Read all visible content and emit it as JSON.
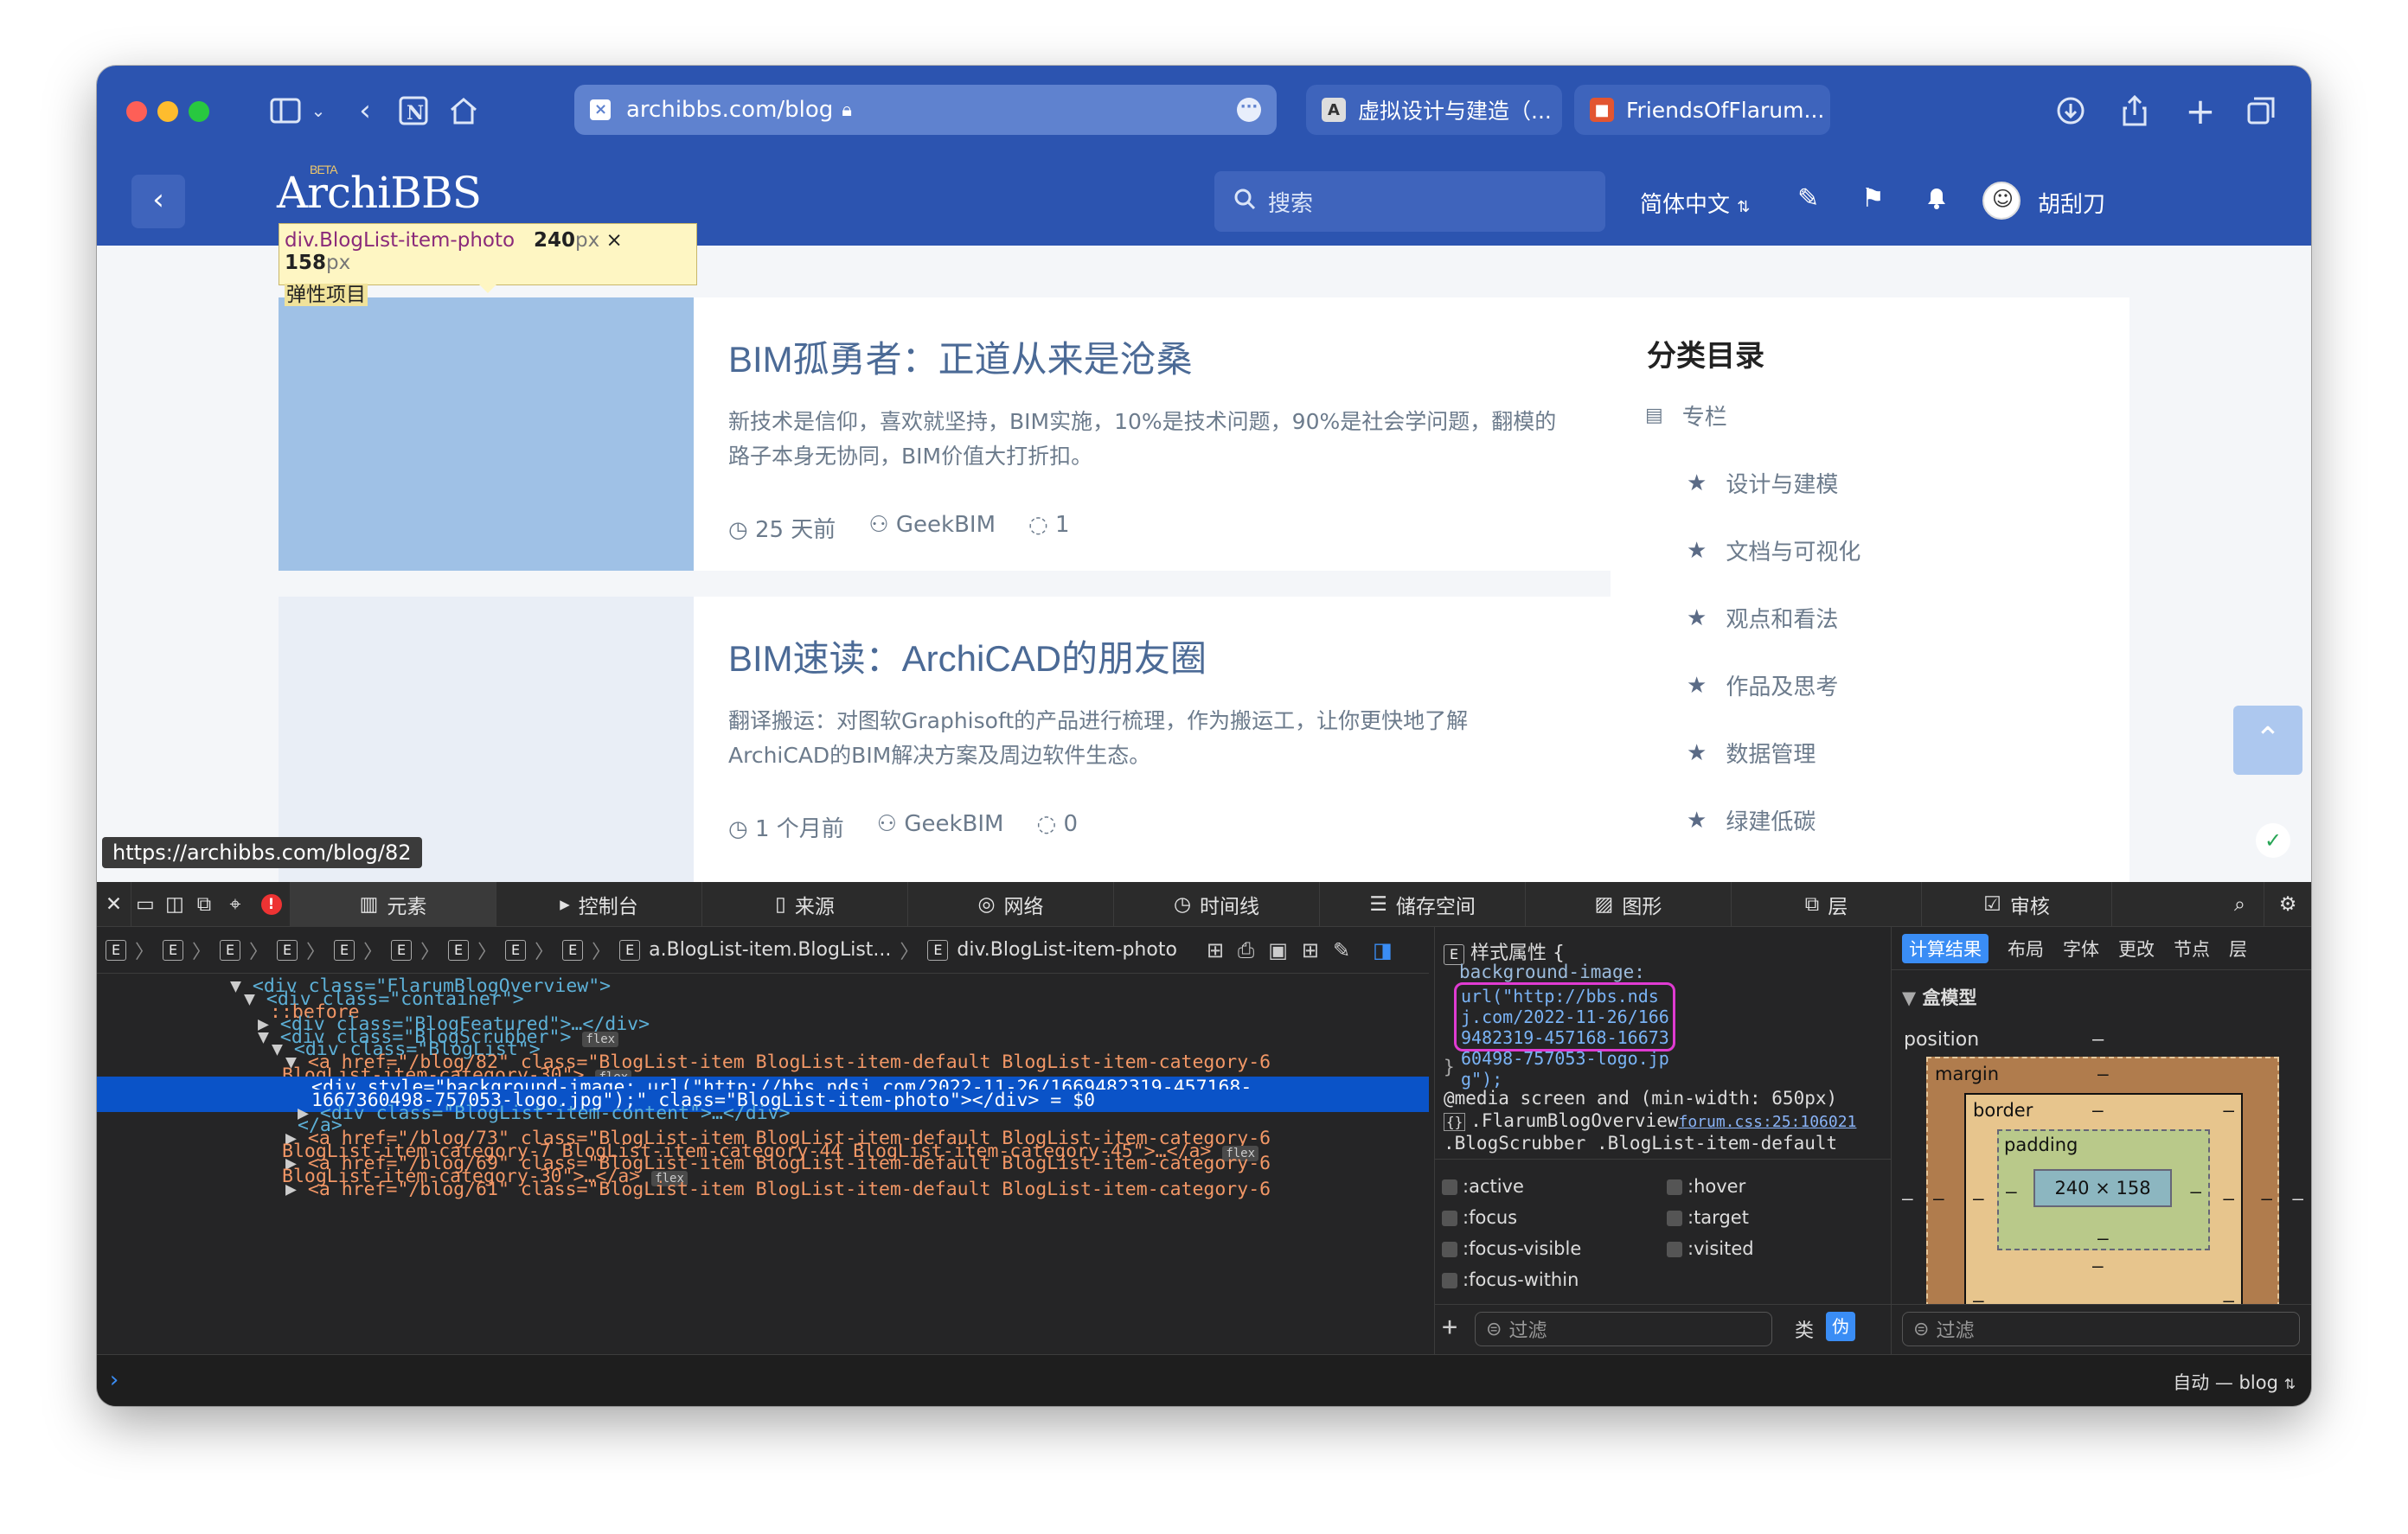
{
  "browser": {
    "url": "archibbs.com/blog",
    "tabs": [
      {
        "label": "虚拟设计与建造（..."
      },
      {
        "label": "FriendsOfFlarum..."
      }
    ]
  },
  "site": {
    "logo": "ArchiBBS",
    "logo_badge": "BETA",
    "search_placeholder": "搜索",
    "language": "简体中文",
    "username": "胡刮刀"
  },
  "tooltip": {
    "selector": "div.BlogList-item-photo",
    "size_w": "240",
    "size_h": "158",
    "unit": "px",
    "times": " × ",
    "label": "弹性项目"
  },
  "posts": [
    {
      "title": "BIM孤勇者：正道从来是沧桑",
      "excerpt": "新技术是信仰，喜欢就坚持，BIM实施，10%是技术问题，90%是社会学问题，翻模的路子本身无协同，BIM价值大打折扣。",
      "time": "25 天前",
      "author": "GeekBIM",
      "comments": "1",
      "photo_color": "#9fc1e6"
    },
    {
      "title": "BIM速读：ArchiCAD的朋友圈",
      "excerpt": "翻译搬运：对图软Graphisoft的产品进行梳理，作为搬运工，让你更快地了解ArchiCAD的BIM解决方案及周边软件生态。",
      "time": "1 个月前",
      "author": "GeekBIM",
      "comments": "0",
      "photo_color": "#e9eef6"
    }
  ],
  "sidebar": {
    "title": "分类目录",
    "root": "专栏",
    "items": [
      "设计与建模",
      "文档与可视化",
      "观点和看法",
      "作品及思考",
      "数据管理",
      "绿建低碳"
    ]
  },
  "status_url": "https://archibbs.com/blog/82",
  "devtools": {
    "tabs": [
      "元素",
      "控制台",
      "来源",
      "网络",
      "时间线",
      "储存空间",
      "图形",
      "层",
      "审核"
    ],
    "breadcrumb_a": "a.BlogList-item.BlogList...",
    "breadcrumb_div": "div.BlogList-item-photo",
    "dom_lines": [
      "<div class=\"FlarumBlogOverview\">",
      "<div class=\"container\">",
      "::before",
      "<div class=\"BlogFeatured\">…</div>",
      "<div class=\"BlogScrubber\">",
      "<div class=\"BlogList\">",
      "<a href=\"/blog/82\" class=\"BlogList-item BlogList-item-default BlogList-item-category-6",
      "BlogList-item-category-30\">",
      "<div style=\"background-image: url(\"http://bbs.ndsj.com/2022-11-26/1669482319-457168-",
      "1667360498-757053-logo.jpg\");\" class=\"BlogList-item-photo\"></div> = $0",
      "<div class=\"BlogList-item-content\">…</div>",
      "</a>",
      "<a href=\"/blog/73\" class=\"BlogList-item BlogList-item-default BlogList-item-category-6",
      "BlogList-item-category-7 BlogList-item-category-44 BlogList-item-category-45\">…</a>",
      "<a href=\"/blog/69\" class=\"BlogList-item BlogList-item-default BlogList-item-category-6",
      "BlogList-item-category-30\">…</a>",
      "<a href=\"/blog/61\" class=\"BlogList-item BlogList-item-default BlogList-item-category-6"
    ],
    "flex_badge": "flex",
    "style_header": "样式属性 {",
    "style_prop": "background-image:",
    "style_value": "url(\"http://bbs.ndsj.com/2022-11-26/1669482319-457168-1667360498-757053-logo.jpg\");",
    "style_close": "}",
    "media": "@media screen and (min-width: 650px)",
    "rule_selector": ".FlarumBlogOverview",
    "rule_selector2": ".BlogScrubber .BlogList-item-default",
    "rule_source": "forum.css:25:106021",
    "pseudo": [
      ":active",
      ":hover",
      ":focus",
      ":target",
      ":focus-visible",
      ":visited",
      ":focus-within"
    ],
    "filter": "过滤",
    "cls_btn": "类",
    "pseudo_btn": "伪",
    "panel_tabs": [
      "计算结果",
      "布局",
      "字体",
      "更改",
      "节点",
      "层"
    ],
    "box_model_title": "盒模型",
    "position_label": "position",
    "margin_label": "margin",
    "border_label": "border",
    "padding_label": "padding",
    "content_size": "240 × 158",
    "dash": "–",
    "console_context": "自动 — blog"
  }
}
